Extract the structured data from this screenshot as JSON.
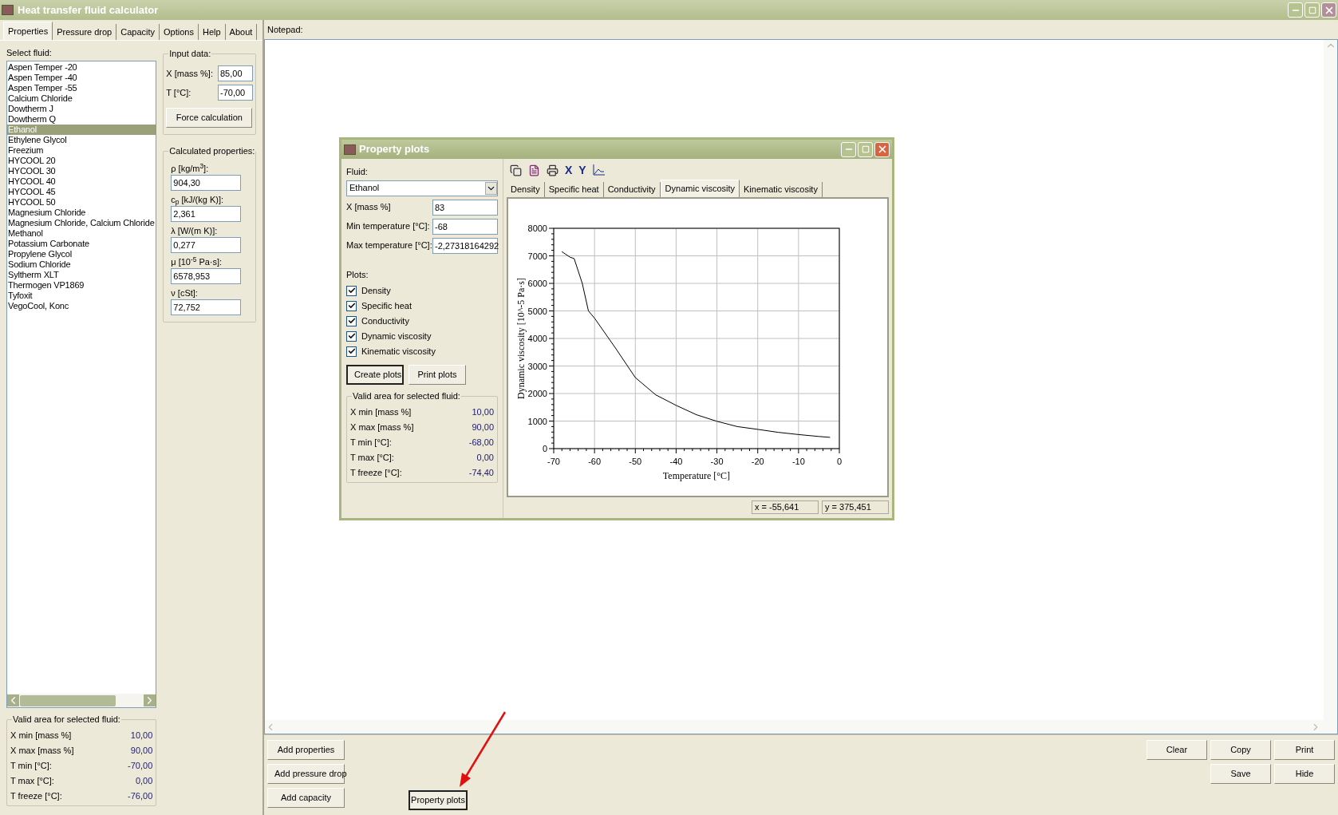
{
  "window": {
    "title": "Heat transfer fluid calculator"
  },
  "tabs": [
    {
      "label": "Properties",
      "selected": true
    },
    {
      "label": "Pressure drop",
      "selected": false
    },
    {
      "label": "Capacity",
      "selected": false
    },
    {
      "label": "Options",
      "selected": false
    },
    {
      "label": "Help",
      "selected": false
    },
    {
      "label": "About",
      "selected": false
    }
  ],
  "fluid_list": {
    "label": "Select fluid:",
    "items": [
      {
        "label": "Aspen Temper -20",
        "selected": false
      },
      {
        "label": "Aspen Temper -40",
        "selected": false
      },
      {
        "label": "Aspen Temper -55",
        "selected": false
      },
      {
        "label": "Calcium Chloride",
        "selected": false
      },
      {
        "label": "Dowtherm J",
        "selected": false
      },
      {
        "label": "Dowtherm Q",
        "selected": false
      },
      {
        "label": "Ethanol",
        "selected": true
      },
      {
        "label": "Ethylene Glycol",
        "selected": false
      },
      {
        "label": "Freezium",
        "selected": false
      },
      {
        "label": "HYCOOL 20",
        "selected": false
      },
      {
        "label": "HYCOOL 30",
        "selected": false
      },
      {
        "label": "HYCOOL 40",
        "selected": false
      },
      {
        "label": "HYCOOL 45",
        "selected": false
      },
      {
        "label": "HYCOOL 50",
        "selected": false
      },
      {
        "label": "Magnesium Chloride",
        "selected": false
      },
      {
        "label": "Magnesium Chloride, Calcium Chloride",
        "selected": false
      },
      {
        "label": "Methanol",
        "selected": false
      },
      {
        "label": "Potassium Carbonate",
        "selected": false
      },
      {
        "label": "Propylene Glycol",
        "selected": false
      },
      {
        "label": "Sodium Chloride",
        "selected": false
      },
      {
        "label": "Syltherm XLT",
        "selected": false
      },
      {
        "label": "Thermogen VP1869",
        "selected": false
      },
      {
        "label": "Tyfoxit",
        "selected": false
      },
      {
        "label": "VegoCool, Konc",
        "selected": false
      }
    ]
  },
  "input_data": {
    "title": "Input data:",
    "fields": [
      {
        "label": "X [mass %]:",
        "value": "85,00"
      },
      {
        "label": "T [°C]:",
        "value": "-70,00"
      }
    ],
    "button": "Force calculation"
  },
  "calculated_properties": {
    "title": "Calculated properties:",
    "fields": [
      {
        "label": "ρ [kg/m$^{3}$]:",
        "value": "904,30"
      },
      {
        "label": "c$_{p}$ [kJ/(kg K)]:",
        "value": "2,361"
      },
      {
        "label": "λ [W/(m K)]:",
        "value": "0,277"
      },
      {
        "label": "μ [10$^{-5}$ Pa·s]:",
        "value": "6578,953"
      },
      {
        "label": "ν [cSt]:",
        "value": "72,752"
      }
    ]
  },
  "valid_area": {
    "title": "Valid area for selected fluid:",
    "rows": [
      {
        "label": "X min [mass %]",
        "value": "10,00"
      },
      {
        "label": "X max [mass %]",
        "value": "90,00"
      },
      {
        "label": "T min [°C]:",
        "value": "-70,00"
      },
      {
        "label": "T max [°C]:",
        "value": "0,00"
      },
      {
        "label": "T freeze [°C]:",
        "value": "-76,00"
      }
    ]
  },
  "notepad": {
    "label": "Notepad:"
  },
  "action_buttons": [
    "Add properties",
    "Add pressure drop",
    "Add capacity"
  ],
  "property_plots_button": "Property plots",
  "notepad_buttons": [
    [
      "Clear",
      "Copy",
      "Print"
    ],
    [
      "Save",
      "Hide"
    ]
  ],
  "dialog": {
    "title": "Property plots",
    "fluid_label": "Fluid:",
    "fluid_value": "Ethanol",
    "fields": [
      {
        "label": "X [mass %]",
        "value": "83"
      },
      {
        "label": "Min temperature [°C]:",
        "value": "-68"
      },
      {
        "label": "Max temperature [°C]:",
        "value": "-2,27318164292"
      }
    ],
    "plots_label": "Plots:",
    "plots": [
      {
        "label": "Density",
        "checked": true
      },
      {
        "label": "Specific heat",
        "checked": true
      },
      {
        "label": "Conductivity",
        "checked": true
      },
      {
        "label": "Dynamic viscosity",
        "checked": true
      },
      {
        "label": "Kinematic viscosity",
        "checked": true
      }
    ],
    "buttons": [
      "Create plots",
      "Print plots"
    ],
    "valid_area": {
      "title": "Valid area for selected fluid:",
      "rows": [
        {
          "label": "X min [mass %]",
          "value": "10,00"
        },
        {
          "label": "X max [mass %]",
          "value": "90,00"
        },
        {
          "label": "T min [°C]:",
          "value": "-68,00"
        },
        {
          "label": "T max [°C]:",
          "value": "0,00"
        },
        {
          "label": "T freeze [°C]:",
          "value": "-74,40"
        }
      ]
    },
    "toolbar_letters": [
      "X",
      "Y"
    ],
    "chart_tabs": [
      {
        "label": "Density",
        "selected": false
      },
      {
        "label": "Specific heat",
        "selected": false
      },
      {
        "label": "Conductivity",
        "selected": false
      },
      {
        "label": "Dynamic viscosity",
        "selected": true
      },
      {
        "label": "Kinematic viscosity",
        "selected": false
      }
    ],
    "chart_data": {
      "type": "line",
      "grid": true,
      "xlabel": "Temperature [°C]",
      "ylabel": "Dynamic viscosity [10^-5 Pa·s]",
      "xlim": [
        -70,
        0
      ],
      "ylim": [
        0,
        8000
      ],
      "xticks": [
        -70,
        -60,
        -50,
        -40,
        -30,
        -20,
        -10,
        0
      ],
      "yticks": [
        0,
        1000,
        2000,
        3000,
        4000,
        5000,
        6000,
        7000,
        8000
      ],
      "x": [
        -68,
        -66,
        -65,
        -63,
        -61.5,
        -60,
        -55,
        -50,
        -45,
        -40,
        -35,
        -30,
        -25,
        -20,
        -15,
        -10,
        -5,
        -2.27
      ],
      "series": [
        {
          "color": "#000000",
          "values": [
            7150,
            6950,
            6900,
            6000,
            5000,
            4740,
            3680,
            2580,
            1950,
            1570,
            1230,
            990,
            800,
            700,
            590,
            510,
            440,
            410
          ]
        }
      ]
    },
    "status": [
      "x = -55,641",
      "y = 375,451"
    ]
  }
}
